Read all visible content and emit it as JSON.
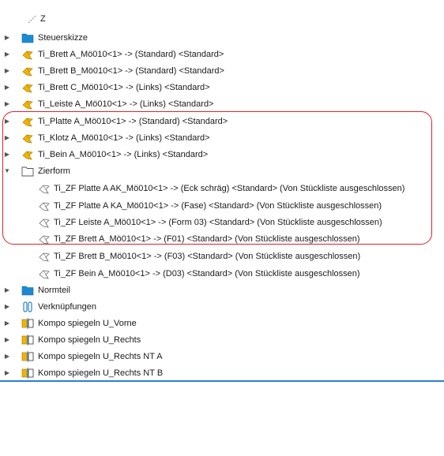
{
  "colors": {
    "accent_divider": "#2a7fd4",
    "highlight_border": "#e0202a",
    "folder": "#1c8ad0",
    "part_gold": "#f0b400"
  },
  "tree": {
    "top_partial": "Z",
    "items": [
      {
        "label": "Steuerskizze",
        "icon": "folder-icon"
      },
      {
        "label": "Ti_Brett A_Mö010<1> -> (Standard) <Standard>",
        "icon": "part-icon"
      },
      {
        "label": "Ti_Brett B_Mö010<1> -> (Standard) <Standard>",
        "icon": "part-icon"
      },
      {
        "label": "Ti_Brett C_Mö010<1> -> (Links) <Standard>",
        "icon": "part-icon"
      },
      {
        "label": "Ti_Leiste A_Mö010<1> -> (Links) <Standard>",
        "icon": "part-icon"
      },
      {
        "label": "Ti_Platte A_Mö010<1> -> (Standard) <Standard>",
        "icon": "part-icon"
      },
      {
        "label": "Ti_Klotz A_Mö010<1> -> (Links) <Standard>",
        "icon": "part-icon"
      },
      {
        "label": "Ti_Bein A_Mö010<1> -> (Links) <Standard>",
        "icon": "part-icon"
      },
      {
        "label": "Zierform",
        "icon": "folder-open-icon"
      },
      {
        "label": "Ti_ZF Platte A AK_Mö010<1> -> (Eck schräg) <Standard> (Von Stückliste ausgeschlossen)",
        "icon": "excluded-part-icon"
      },
      {
        "label": "Ti_ZF Platte A KA_Mö010<1> -> (Fase) <Standard> (Von Stückliste ausgeschlossen)",
        "icon": "excluded-part-icon"
      },
      {
        "label": "Ti_ZF Leiste A_Mö010<1> -> (Form 03) <Standard> (Von Stückliste ausgeschlossen)",
        "icon": "excluded-part-icon"
      },
      {
        "label": "Ti_ZF Brett A_Mö010<1> -> (F01) <Standard> (Von Stückliste ausgeschlossen)",
        "icon": "excluded-part-icon"
      },
      {
        "label": "Ti_ZF Brett B_Mö010<1> -> (F03) <Standard> (Von Stückliste ausgeschlossen)",
        "icon": "excluded-part-icon"
      },
      {
        "label": "Ti_ZF Bein A_Mö010<1> -> (D03) <Standard> (Von Stückliste ausgeschlossen)",
        "icon": "excluded-part-icon"
      },
      {
        "label": "Normteil",
        "icon": "folder-icon"
      },
      {
        "label": "Verknüpfungen",
        "icon": "mates-icon"
      },
      {
        "label": "Kompo spiegeln U_Vorne",
        "icon": "mirror-component-icon"
      },
      {
        "label": "Kompo spiegeln U_Rechts",
        "icon": "mirror-component-icon"
      },
      {
        "label": "Kompo spiegeln U_Rechts NT A",
        "icon": "mirror-component-icon"
      },
      {
        "label": "Kompo spiegeln U_Rechts NT B",
        "icon": "mirror-component-icon"
      }
    ]
  }
}
